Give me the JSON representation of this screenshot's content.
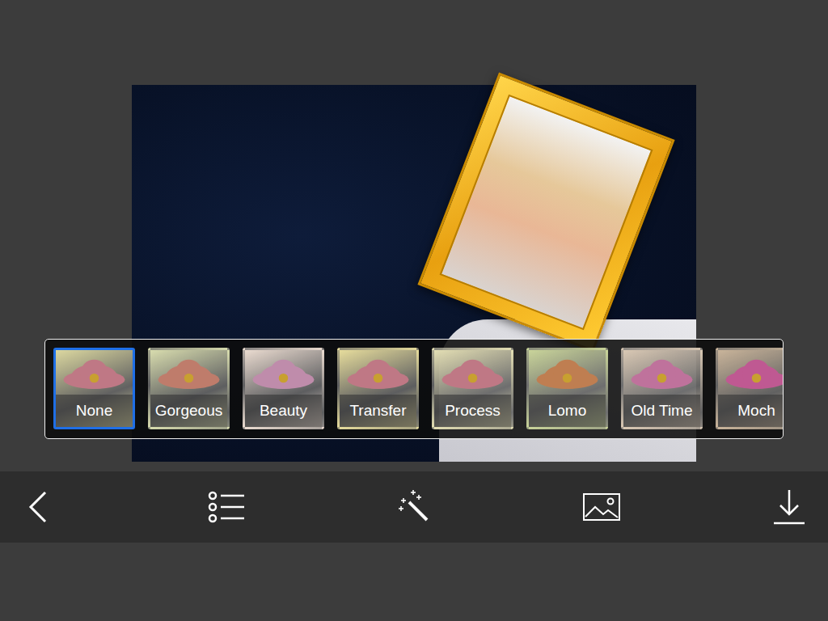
{
  "filters": [
    {
      "label": "None",
      "selected": true,
      "color": "#dcd8a0"
    },
    {
      "label": "Gorgeous",
      "selected": false,
      "color": "#d8dcae"
    },
    {
      "label": "Beauty",
      "selected": false,
      "color": "#eadbd0"
    },
    {
      "label": "Transfer",
      "selected": false,
      "color": "#e6dc9c"
    },
    {
      "label": "Process",
      "selected": false,
      "color": "#e4dfb4"
    },
    {
      "label": "Lomo",
      "selected": false,
      "color": "#c9d49a"
    },
    {
      "label": "Old Time",
      "selected": false,
      "color": "#d9c8b4"
    },
    {
      "label": "Moch",
      "selected": false,
      "color": "#c9b49a"
    }
  ]
}
